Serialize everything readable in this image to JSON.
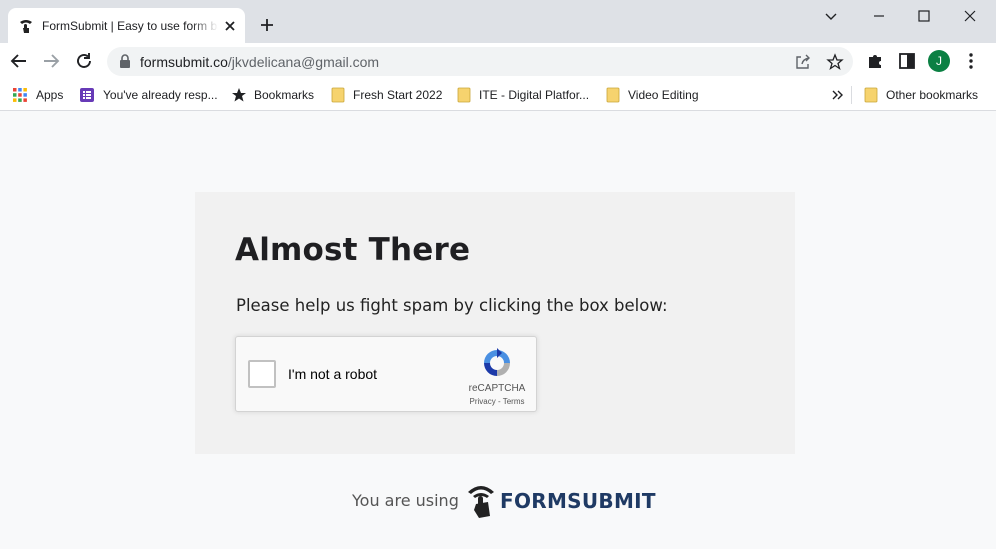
{
  "browser": {
    "tab": {
      "title": "FormSubmit | Easy to use form backend"
    },
    "url": {
      "domain": "formsubmit.co",
      "path": "/jkvdelicana@gmail.com"
    },
    "profile_initial": "J"
  },
  "bookmarks": {
    "items": [
      {
        "label": "Apps",
        "icon": "apps-grid-icon"
      },
      {
        "label": "You've already resp...",
        "icon": "forms-icon"
      },
      {
        "label": "Bookmarks",
        "icon": "star-icon"
      },
      {
        "label": "Fresh Start 2022",
        "icon": "folder-icon"
      },
      {
        "label": "ITE - Digital Platfor...",
        "icon": "folder-icon"
      },
      {
        "label": "Video Editing",
        "icon": "folder-icon"
      }
    ],
    "other": "Other bookmarks"
  },
  "page": {
    "heading": "Almost There",
    "subtext": "Please help us fight spam by clicking the box below:",
    "recaptcha": {
      "label": "I'm not a robot",
      "brand": "reCAPTCHA",
      "links": "Privacy - Terms",
      "checked": false
    },
    "footer": {
      "text": "You are using",
      "brand": "FORMSUBMIT"
    }
  },
  "colors": {
    "titlebar": "#dee1e6",
    "page_bg": "#f8f9fa",
    "card_bg": "#f1f1f1",
    "brand_navy": "#1f3a64",
    "avatar": "#0b8043",
    "folder": "#f6d36e"
  }
}
